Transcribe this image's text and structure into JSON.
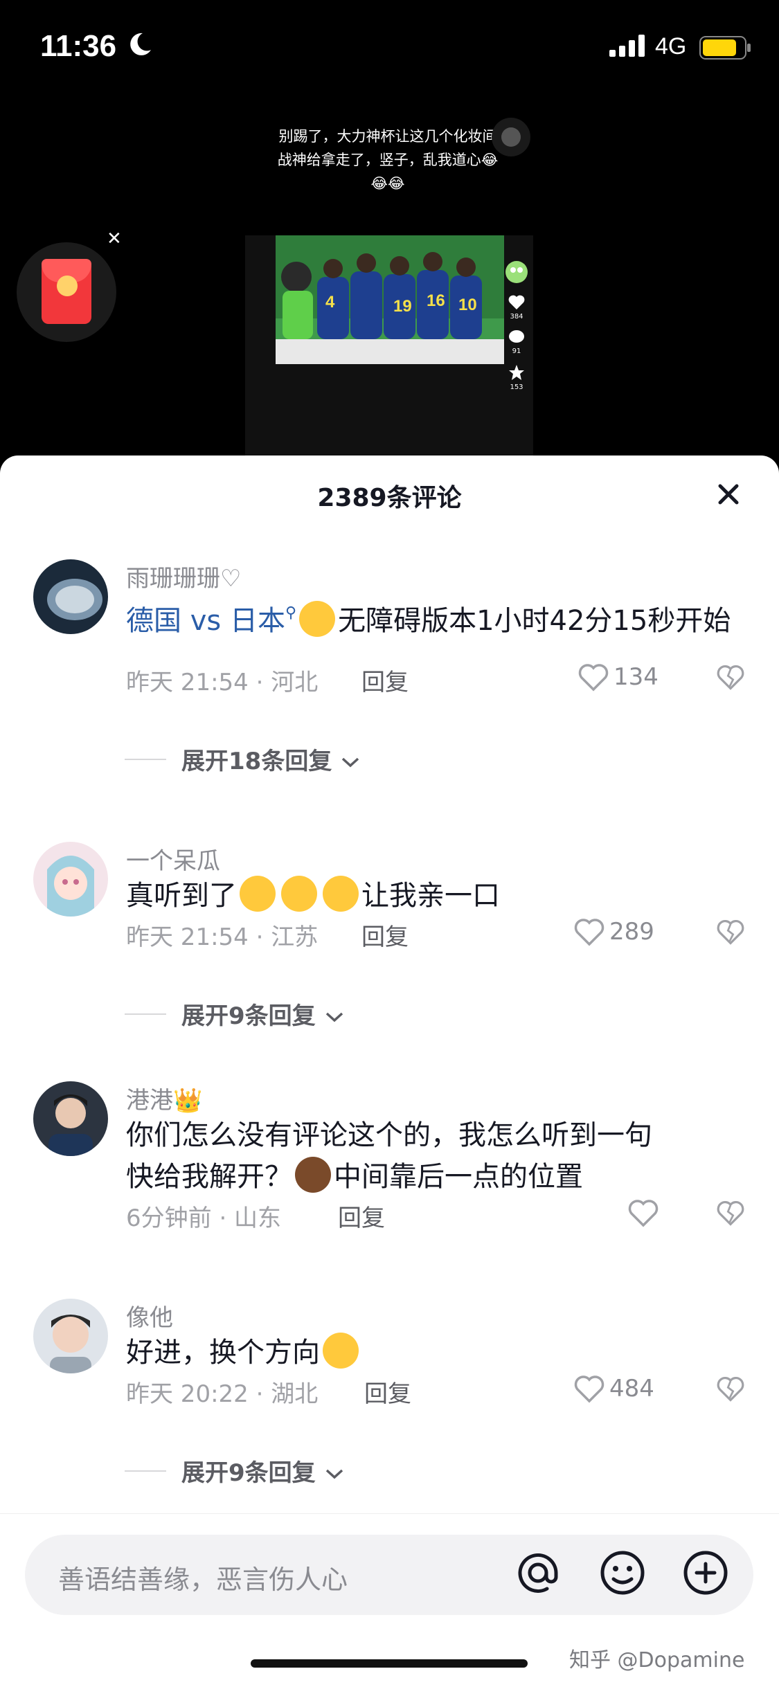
{
  "status_bar": {
    "time": "11:36",
    "network": "4G"
  },
  "video": {
    "caption": "别踢了，大力神杯让这几个化妆间战神给拿走了，竖子，乱我道心😂😂😂",
    "side_counts": {
      "like": "384",
      "comment": "91",
      "star": "153"
    }
  },
  "sheet": {
    "title": "2389条评论"
  },
  "comments": [
    {
      "username": "雨珊珊珊♡",
      "tag1": "德国",
      "mid": " vs ",
      "tag2": "日本",
      "text": "无障碍版本1小时42分15秒开始",
      "time_loc": "昨天 21:54 · 河北",
      "reply": "回复",
      "likes": "134",
      "expand": "展开18条回复"
    },
    {
      "username": "一个呆瓜",
      "text_prefix": "真听到了",
      "text_suffix": "让我亲一口",
      "time_loc": "昨天 21:54 · 江苏",
      "reply": "回复",
      "likes": "289",
      "expand": "展开9条回复"
    },
    {
      "username": "港港👑",
      "line1": "你们怎么没有评论这个的，我怎么听到一句",
      "line2_prefix": "快给我解开？",
      "line2_suffix": "中间靠后一点的位置",
      "time_loc": "6分钟前 · 山东",
      "reply": "回复",
      "likes": ""
    },
    {
      "username": "像他",
      "text": "好进，换个方向",
      "time_loc": "昨天 20:22 · 湖北",
      "reply": "回复",
      "likes": "484",
      "expand": "展开9条回复"
    }
  ],
  "input": {
    "placeholder": "善语结善缘，恶言伤人心"
  },
  "watermark": "知乎 @Dopamine",
  "colors": {
    "accent_link": "#2a5da8",
    "redpack": "#f2373b"
  }
}
